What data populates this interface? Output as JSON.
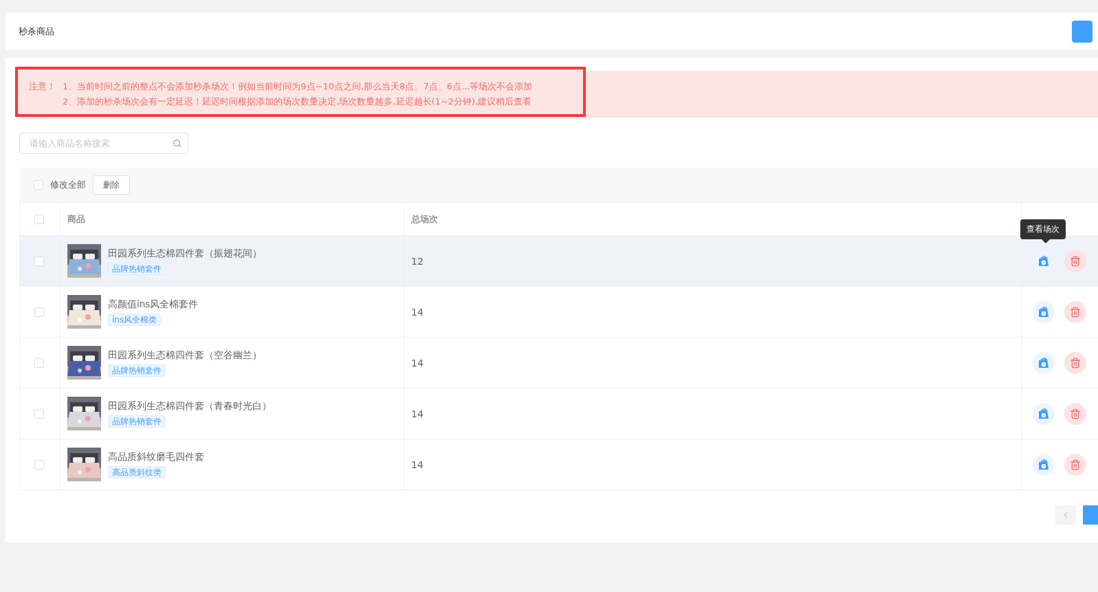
{
  "header": {
    "title": "秒杀商品"
  },
  "notice": {
    "label": "注意！",
    "lines": [
      "1、当前时间之前的整点不会添加秒杀场次！例如当前时间为9点~10点之间,那么当天8点、7点、6点...等场次不会添加",
      "2、添加的秒杀场次会有一定延迟！延迟时间根据添加的场次数量决定,场次数量越多,延迟越长(1~2分钟),建议稍后查看"
    ]
  },
  "search": {
    "placeholder": "请输入商品名称搜索"
  },
  "toolbar": {
    "select_all": {
      "label": "修改全部",
      "checked": false
    },
    "delete_button": "删除"
  },
  "table": {
    "columns": [
      "商品",
      "总场次"
    ],
    "header_checked": false,
    "rows": [
      {
        "checked": false,
        "highlighted": true,
        "name": "田园系列生态棉四件套（振翅花间）",
        "tag": "品牌热销套件",
        "sessions": "12",
        "tooltip": "查看场次"
      },
      {
        "checked": false,
        "highlighted": false,
        "name": "高颜值ins风全棉套件",
        "tag": "ins风全棉类",
        "sessions": "14"
      },
      {
        "checked": false,
        "highlighted": false,
        "name": "田园系列生态棉四件套（空谷幽兰）",
        "tag": "品牌热销套件",
        "sessions": "14"
      },
      {
        "checked": false,
        "highlighted": false,
        "name": "田园系列生态棉四件套（青春时光白）",
        "tag": "品牌热销套件",
        "sessions": "14"
      },
      {
        "checked": false,
        "highlighted": false,
        "name": "高品质斜纹磨毛四件套",
        "tag": "高品质斜纹类",
        "sessions": "14"
      }
    ]
  }
}
